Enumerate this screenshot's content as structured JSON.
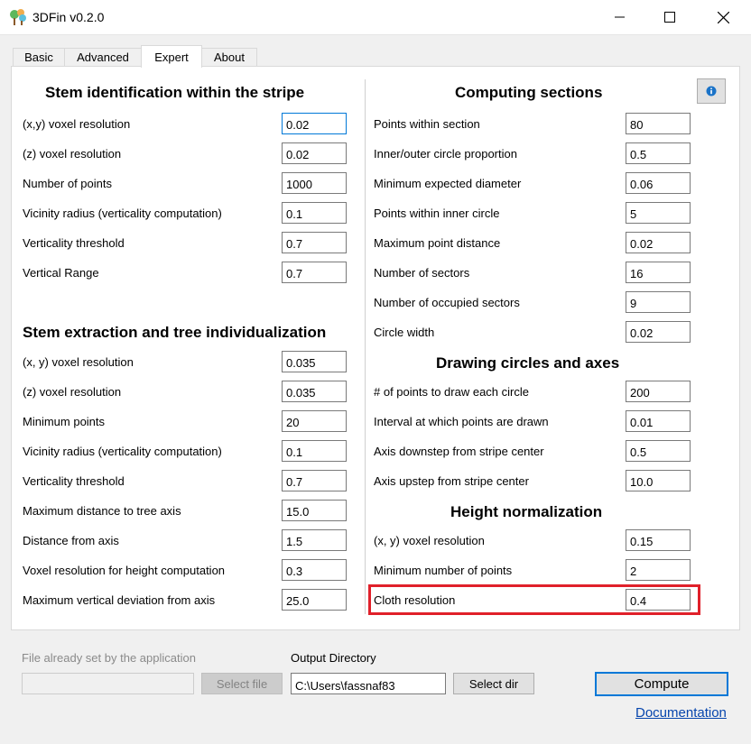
{
  "window": {
    "title": "3DFin v0.2.0"
  },
  "tabs": [
    {
      "label": "Basic",
      "active": false
    },
    {
      "label": "Advanced",
      "active": false
    },
    {
      "label": "Expert",
      "active": true
    },
    {
      "label": "About",
      "active": false
    }
  ],
  "stem_identification": {
    "title": "Stem identification within the stripe",
    "fields": [
      {
        "label": "(x,y) voxel resolution",
        "value": "0.02"
      },
      {
        "label": "(z) voxel resolution",
        "value": "0.02"
      },
      {
        "label": "Number of points",
        "value": "1000"
      },
      {
        "label": "Vicinity radius (verticality computation)",
        "value": "0.1"
      },
      {
        "label": "Verticality threshold",
        "value": "0.7"
      },
      {
        "label": "Vertical Range",
        "value": "0.7"
      }
    ]
  },
  "stem_extraction": {
    "title": "Stem extraction and tree individualization",
    "fields": [
      {
        "label": "(x, y) voxel resolution",
        "value": "0.035"
      },
      {
        "label": "(z) voxel resolution",
        "value": "0.035"
      },
      {
        "label": "Minimum points",
        "value": "20"
      },
      {
        "label": "Vicinity radius (verticality computation)",
        "value": "0.1"
      },
      {
        "label": "Verticality threshold",
        "value": "0.7"
      },
      {
        "label": "Maximum distance to tree axis",
        "value": "15.0"
      },
      {
        "label": "Distance from axis",
        "value": "1.5"
      },
      {
        "label": "Voxel resolution for height computation",
        "value": "0.3"
      },
      {
        "label": "Maximum vertical deviation from axis",
        "value": "25.0"
      }
    ]
  },
  "computing_sections": {
    "title": "Computing sections",
    "fields": [
      {
        "label": "Points within section",
        "value": "80"
      },
      {
        "label": "Inner/outer circle proportion",
        "value": "0.5"
      },
      {
        "label": "Minimum expected diameter",
        "value": "0.06"
      },
      {
        "label": "Points within inner circle",
        "value": "5"
      },
      {
        "label": "Maximum point distance",
        "value": "0.02"
      },
      {
        "label": "Number of sectors",
        "value": "16"
      },
      {
        "label": "Number of occupied sectors",
        "value": "9"
      },
      {
        "label": "Circle width",
        "value": "0.02"
      }
    ]
  },
  "drawing_circles": {
    "title": "Drawing circles and axes",
    "fields": [
      {
        "label": "# of points to draw each circle",
        "value": "200"
      },
      {
        "label": "Interval at which points are drawn",
        "value": "0.01"
      },
      {
        "label": "Axis downstep from stripe center",
        "value": "0.5"
      },
      {
        "label": "Axis upstep from stripe center",
        "value": "10.0"
      }
    ]
  },
  "height_normalization": {
    "title": "Height normalization",
    "fields": [
      {
        "label": "(x, y) voxel resolution",
        "value": "0.15"
      },
      {
        "label": "Minimum number of points",
        "value": "2"
      },
      {
        "label": "Cloth resolution",
        "value": "0.4"
      }
    ]
  },
  "bottom": {
    "file_label": "File already set by the application",
    "file_value": "",
    "select_file": "Select file",
    "output_label": "Output Directory",
    "output_value": "C:\\Users\\fassnaf83",
    "select_dir": "Select dir",
    "compute": "Compute",
    "documentation": "Documentation"
  },
  "colors": {
    "highlight": "#e0202a",
    "accent": "#0078d7",
    "link": "#0645ad"
  },
  "icons": [
    "app-tree-icon",
    "minimize-icon",
    "maximize-icon",
    "close-icon",
    "info-icon"
  ]
}
